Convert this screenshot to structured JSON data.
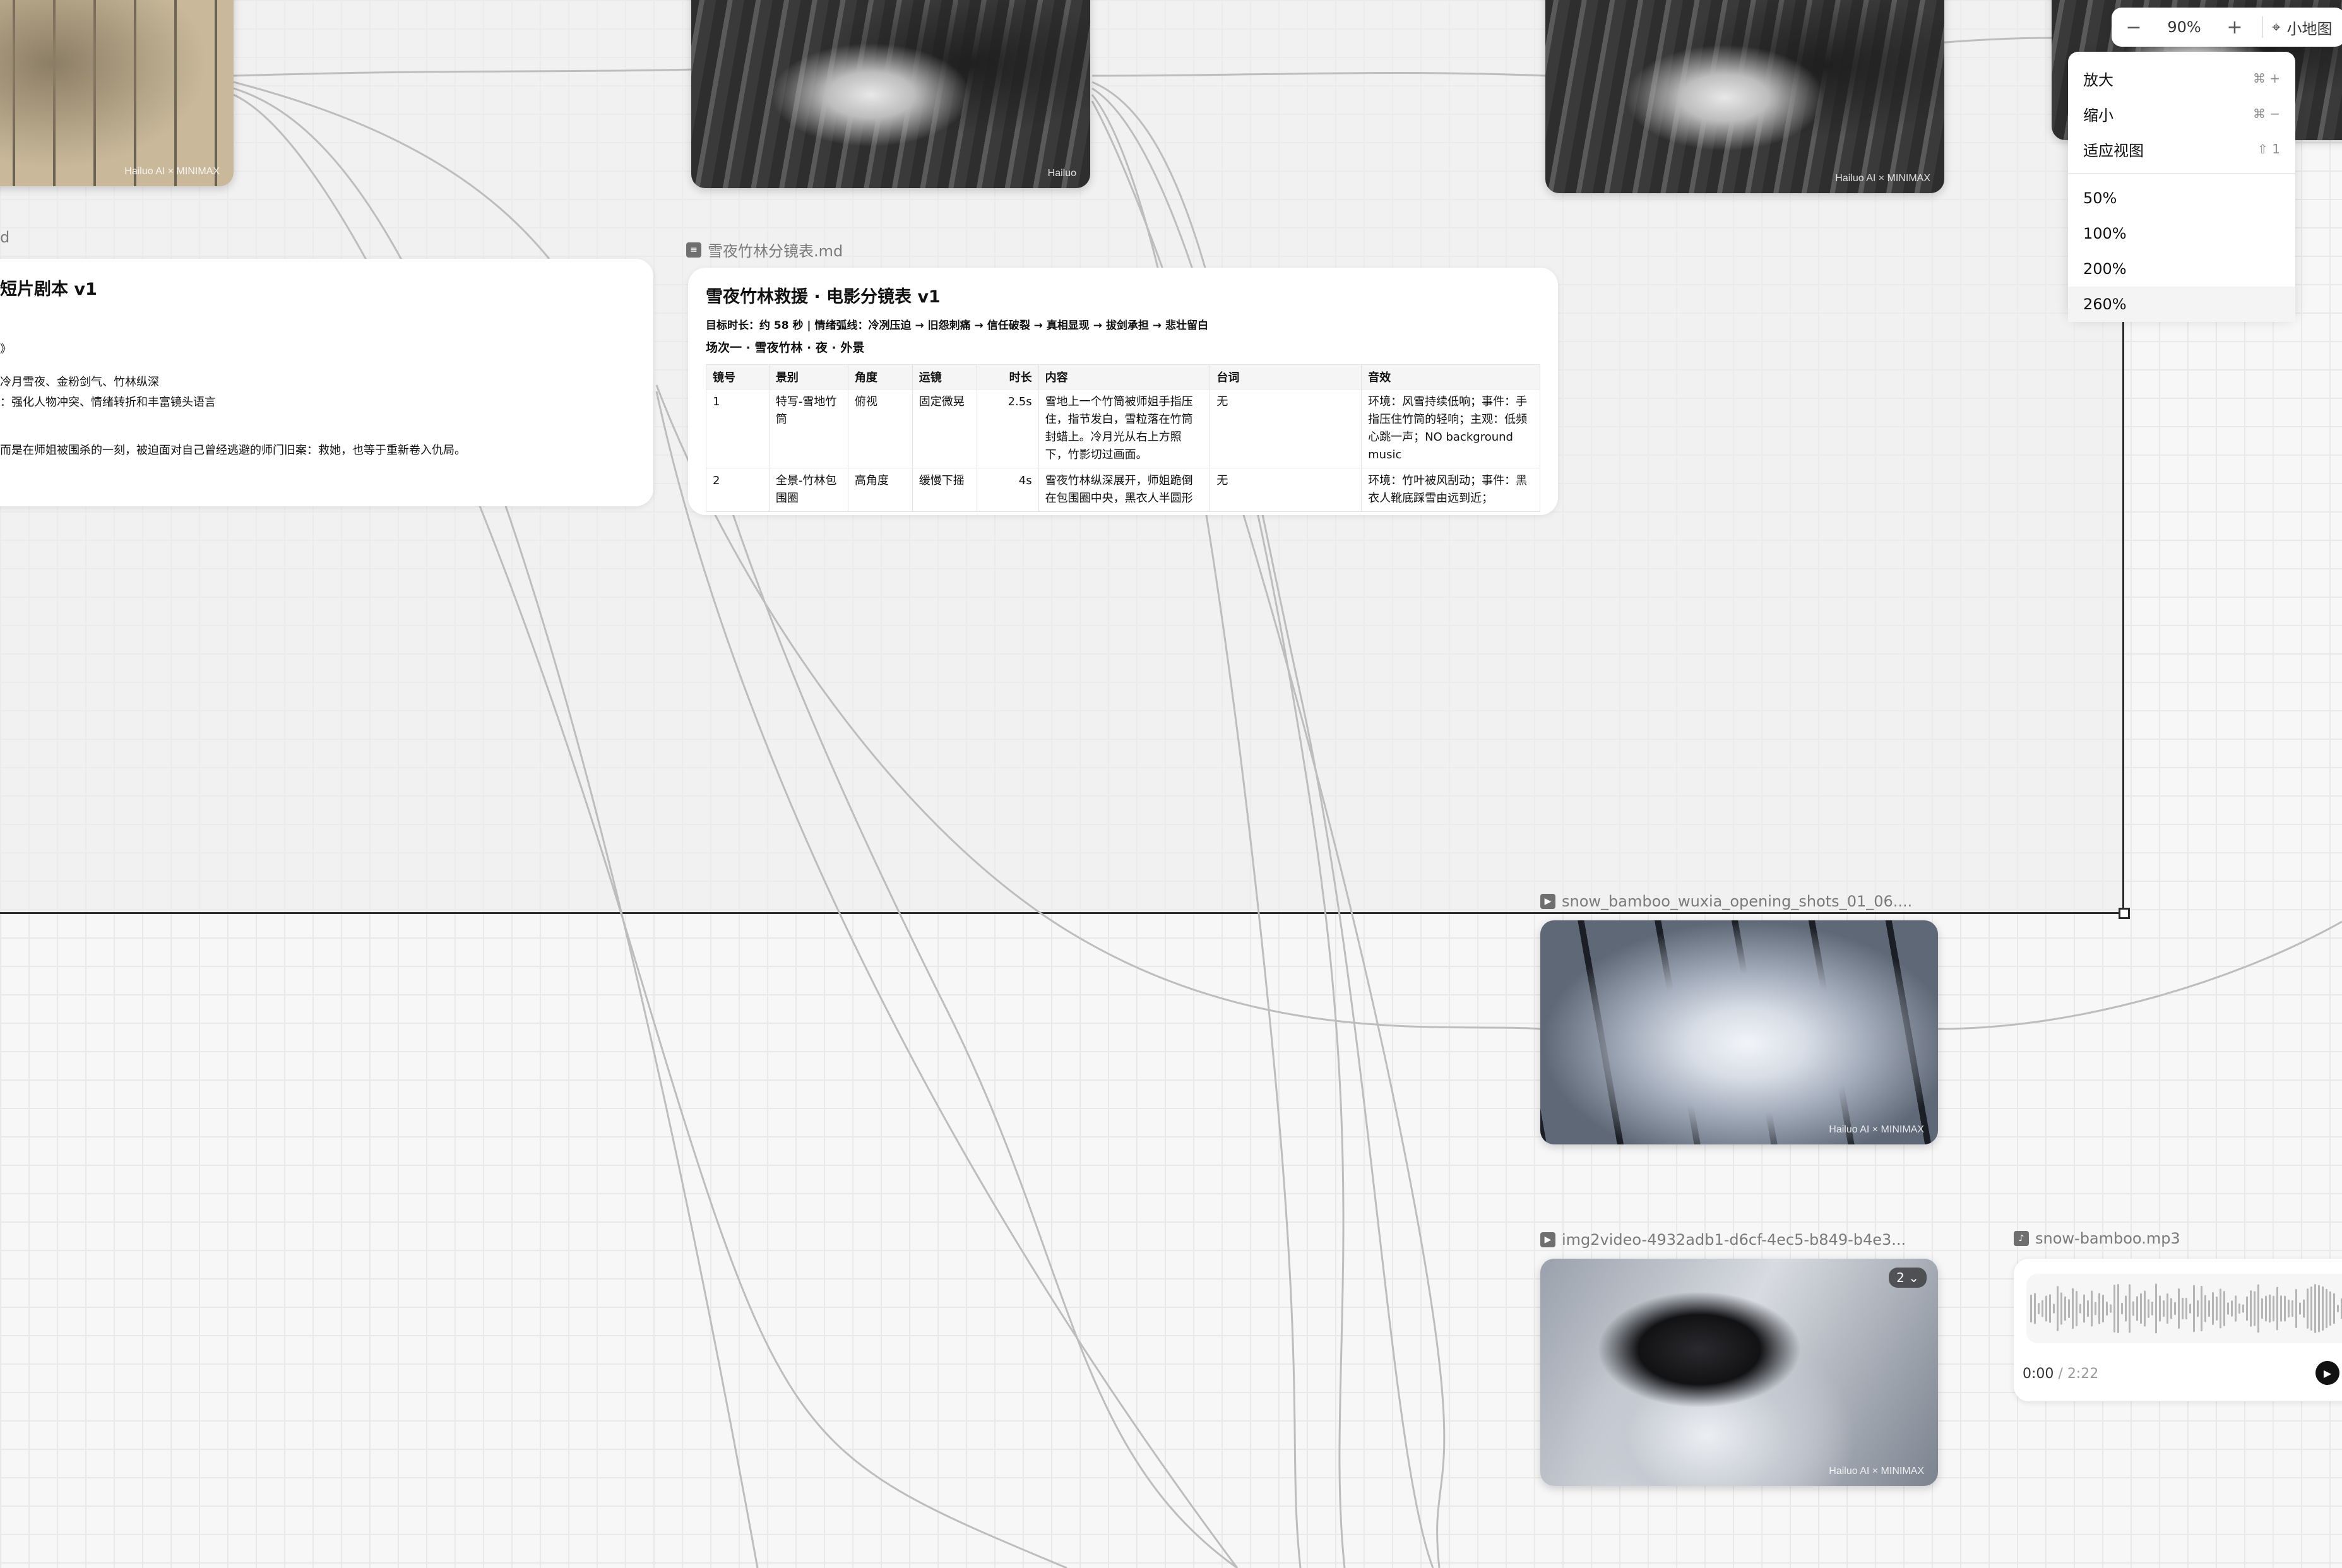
{
  "canvas": {
    "script_card": {
      "label_fragment": "d",
      "title": "短片剧本 v1",
      "lines": [
        "》",
        "冷月雪夜、金粉剑气、竹林纵深",
        "：强化人物冲突、情绪转折和丰富镜头语言",
        "而是在师姐被围杀的一刻，被迫面对自己曾经逃避的师门旧案：救她，也等于重新卷入仇局。"
      ]
    },
    "storyboard": {
      "file_label": "雪夜竹林分镜表.md",
      "title": "雪夜竹林救援 · 电影分镜表 v1",
      "meta": "目标时长：约 58 秒 | 情绪弧线：冷冽压迫 → 旧怨刺痛 → 信任破裂 → 真相显现 → 拔剑承担 → 悲壮留白",
      "scene": "场次一 · 雪夜竹林 · 夜 · 外景",
      "columns": [
        "镜号",
        "景别",
        "角度",
        "运镜",
        "时长",
        "内容",
        "台词",
        "音效"
      ],
      "rows": [
        {
          "no": "1",
          "shot": "特写-雪地竹筒",
          "angle": "俯视",
          "move": "固定微晃",
          "dur": "2.5s",
          "content": "雪地上一个竹筒被师姐手指压住，指节发白，雪粒落在竹筒封蜡上。冷月光从右上方照下，竹影切过画面。",
          "line": "无",
          "sfx": "环境：风雪持续低响；事件：手指压住竹筒的轻响；主观：低频心跳一声；NO background music"
        },
        {
          "no": "2",
          "shot": "全景-竹林包围圈",
          "angle": "高角度",
          "move": "缓慢下摇",
          "dur": "4s",
          "content": "雪夜竹林纵深展开，师姐跪倒在包围圈中央，黑衣人半圆形",
          "line": "无",
          "sfx": "环境：竹叶被风刮动；事件：黑衣人靴底踩雪由远到近；"
        }
      ]
    },
    "image_nodes": [
      {
        "name": "top-left-image",
        "watermark": "Hailuo AI  ×  MINIMAX"
      },
      {
        "name": "top-center-image",
        "watermark": "Hailuo"
      },
      {
        "name": "top-right-image",
        "watermark": "Hailuo AI  ×  MINIMAX"
      }
    ],
    "video_1": {
      "label": "snow_bamboo_wuxia_opening_shots_01_06....",
      "watermark": "Hailuo AI  ×  MINIMAX"
    },
    "video_2": {
      "label": "img2video-4932adb1-d6cf-4ec5-b849-b4e3...",
      "badge": "2 ⌄",
      "watermark": "Hailuo AI  ×  MINIMAX"
    },
    "audio": {
      "label": "snow-bamboo.mp3",
      "current": "0:00",
      "separator": " / ",
      "duration": "2:22"
    }
  },
  "zoom_bar": {
    "minus": "−",
    "value": "90%",
    "plus": "+",
    "minimap_label": "小地图"
  },
  "zoom_menu": {
    "items": [
      {
        "label": "放大",
        "shortcut": "⌘ +"
      },
      {
        "label": "缩小",
        "shortcut": "⌘ −"
      },
      {
        "label": "适应视图",
        "shortcut": "⇧ 1"
      }
    ],
    "presets": [
      "50%",
      "100%",
      "200%",
      "260%"
    ]
  },
  "colors": {
    "canvas_bg": "#f7f7f7",
    "selection_border": "#2a2a2a",
    "edge": "#bdbdbd"
  }
}
